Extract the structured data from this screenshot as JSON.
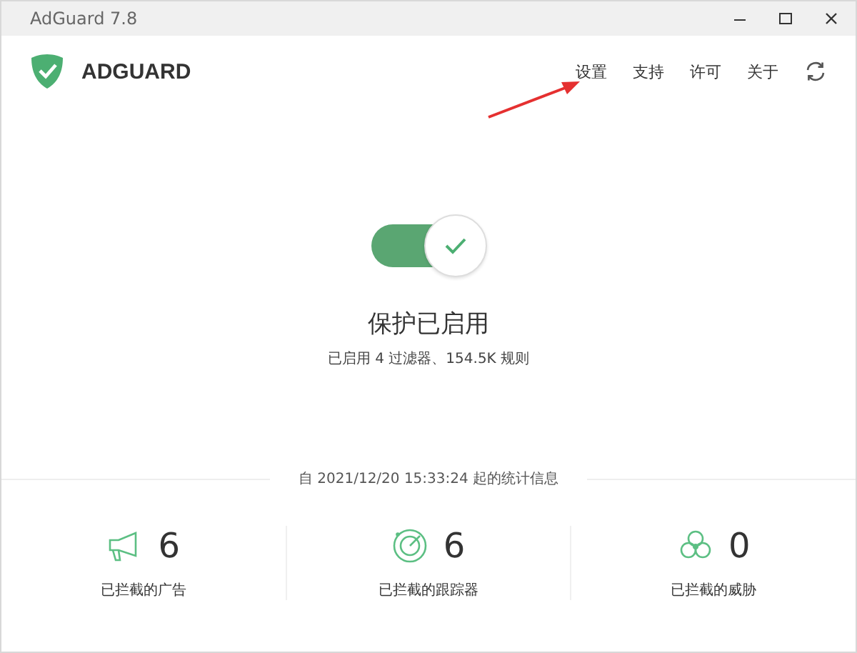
{
  "window": {
    "title": "AdGuard 7.8"
  },
  "brand": "ADGUARD",
  "nav": [
    {
      "label": "设置"
    },
    {
      "label": "支持"
    },
    {
      "label": "许可"
    },
    {
      "label": "关于"
    }
  ],
  "protection": {
    "on": true,
    "title": "保护已启用",
    "subtitle": "已启用 4 过滤器、154.5K 规则"
  },
  "stats_since": "自 2021/12/20 15:33:24 起的统计信息",
  "stats": [
    {
      "kind": "ads",
      "count": "6",
      "label": "已拦截的广告"
    },
    {
      "kind": "trackers",
      "count": "6",
      "label": "已拦截的跟踪器"
    },
    {
      "kind": "threats",
      "count": "0",
      "label": "已拦截的威胁"
    }
  ]
}
